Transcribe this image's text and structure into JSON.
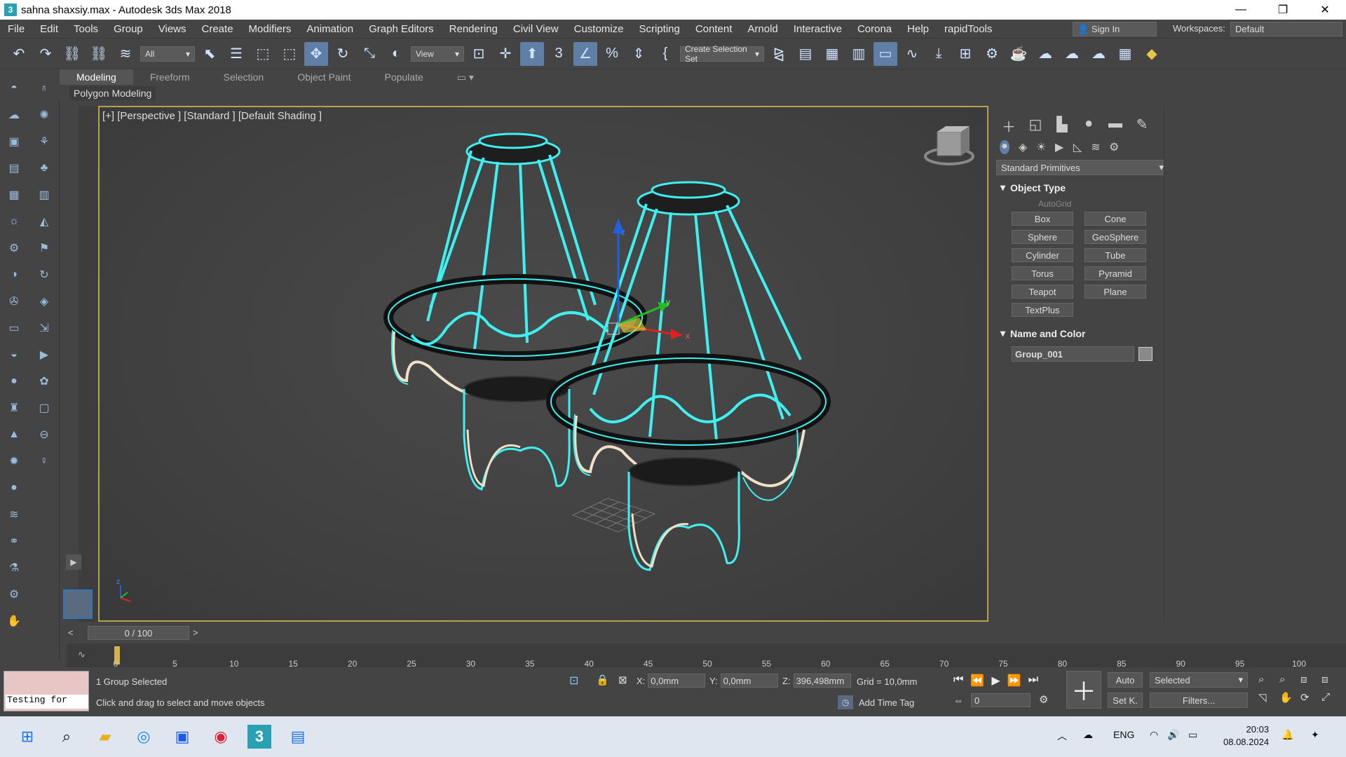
{
  "window": {
    "title": "sahna shaxsiy.max - Autodesk 3ds Max 2018",
    "app_icon": "3",
    "minimize": "—",
    "restore": "❐",
    "close": "✕"
  },
  "menu": [
    "File",
    "Edit",
    "Tools",
    "Group",
    "Views",
    "Create",
    "Modifiers",
    "Animation",
    "Graph Editors",
    "Rendering",
    "Civil View",
    "Customize",
    "Scripting",
    "Content",
    "Arnold",
    "Interactive",
    "Corona",
    "Help",
    "rapidTools"
  ],
  "signin": {
    "label": "Sign In"
  },
  "workspaces": {
    "label": "Workspaces:",
    "value": "Default"
  },
  "toolbar": {
    "filter": "All",
    "ref_coord": "View",
    "selection_set": "Create Selection Set"
  },
  "ribbon": {
    "tabs": [
      "Modeling",
      "Freeform",
      "Selection",
      "Object Paint",
      "Populate"
    ],
    "active": "Modeling",
    "sub": "Polygon Modeling"
  },
  "viewport": {
    "label": "[+] [Perspective ] [Standard ] [Default Shading ]",
    "axis_x": "x",
    "axis_y": "y",
    "axis_z": "z"
  },
  "command_panel": {
    "category": "Standard Primitives",
    "object_type": {
      "title": "Object Type",
      "autogrid": "AutoGrid",
      "buttons": [
        "Box",
        "Cone",
        "Sphere",
        "GeoSphere",
        "Cylinder",
        "Tube",
        "Torus",
        "Pyramid",
        "Teapot",
        "Plane",
        "TextPlus"
      ]
    },
    "name_color": {
      "title": "Name and Color",
      "name": "Group_001",
      "swatch": "#8a8a8a"
    }
  },
  "timeslider": {
    "frame": "0 / 100",
    "prev": "<",
    "next": ">"
  },
  "trackbar": {
    "ticks": [
      "0",
      "5",
      "10",
      "15",
      "20",
      "25",
      "30",
      "35",
      "40",
      "45",
      "50",
      "55",
      "60",
      "65",
      "70",
      "75",
      "80",
      "85",
      "90",
      "95",
      "100"
    ]
  },
  "status": {
    "maxscript": "Testing for ",
    "selection": "1 Group Selected",
    "prompt": "Click and drag to select and move objects",
    "x_label": "X:",
    "x": "0,0mm",
    "y_label": "Y:",
    "y": "0,0mm",
    "z_label": "Z:",
    "z": "396,498mm",
    "grid": "Grid = 10,0mm",
    "add_time_tag": "Add Time Tag",
    "frame": "0",
    "auto": "Auto",
    "setk": "Set K.",
    "key_mode": "Selected",
    "filters": "Filters..."
  },
  "taskbar": {
    "lang": "ENG",
    "time": "20:03",
    "date": "08.08.2024"
  },
  "colors": {
    "wire": "#3ff0f0",
    "accent": "#5f7fa6",
    "viewport_border": "#b8a050"
  }
}
